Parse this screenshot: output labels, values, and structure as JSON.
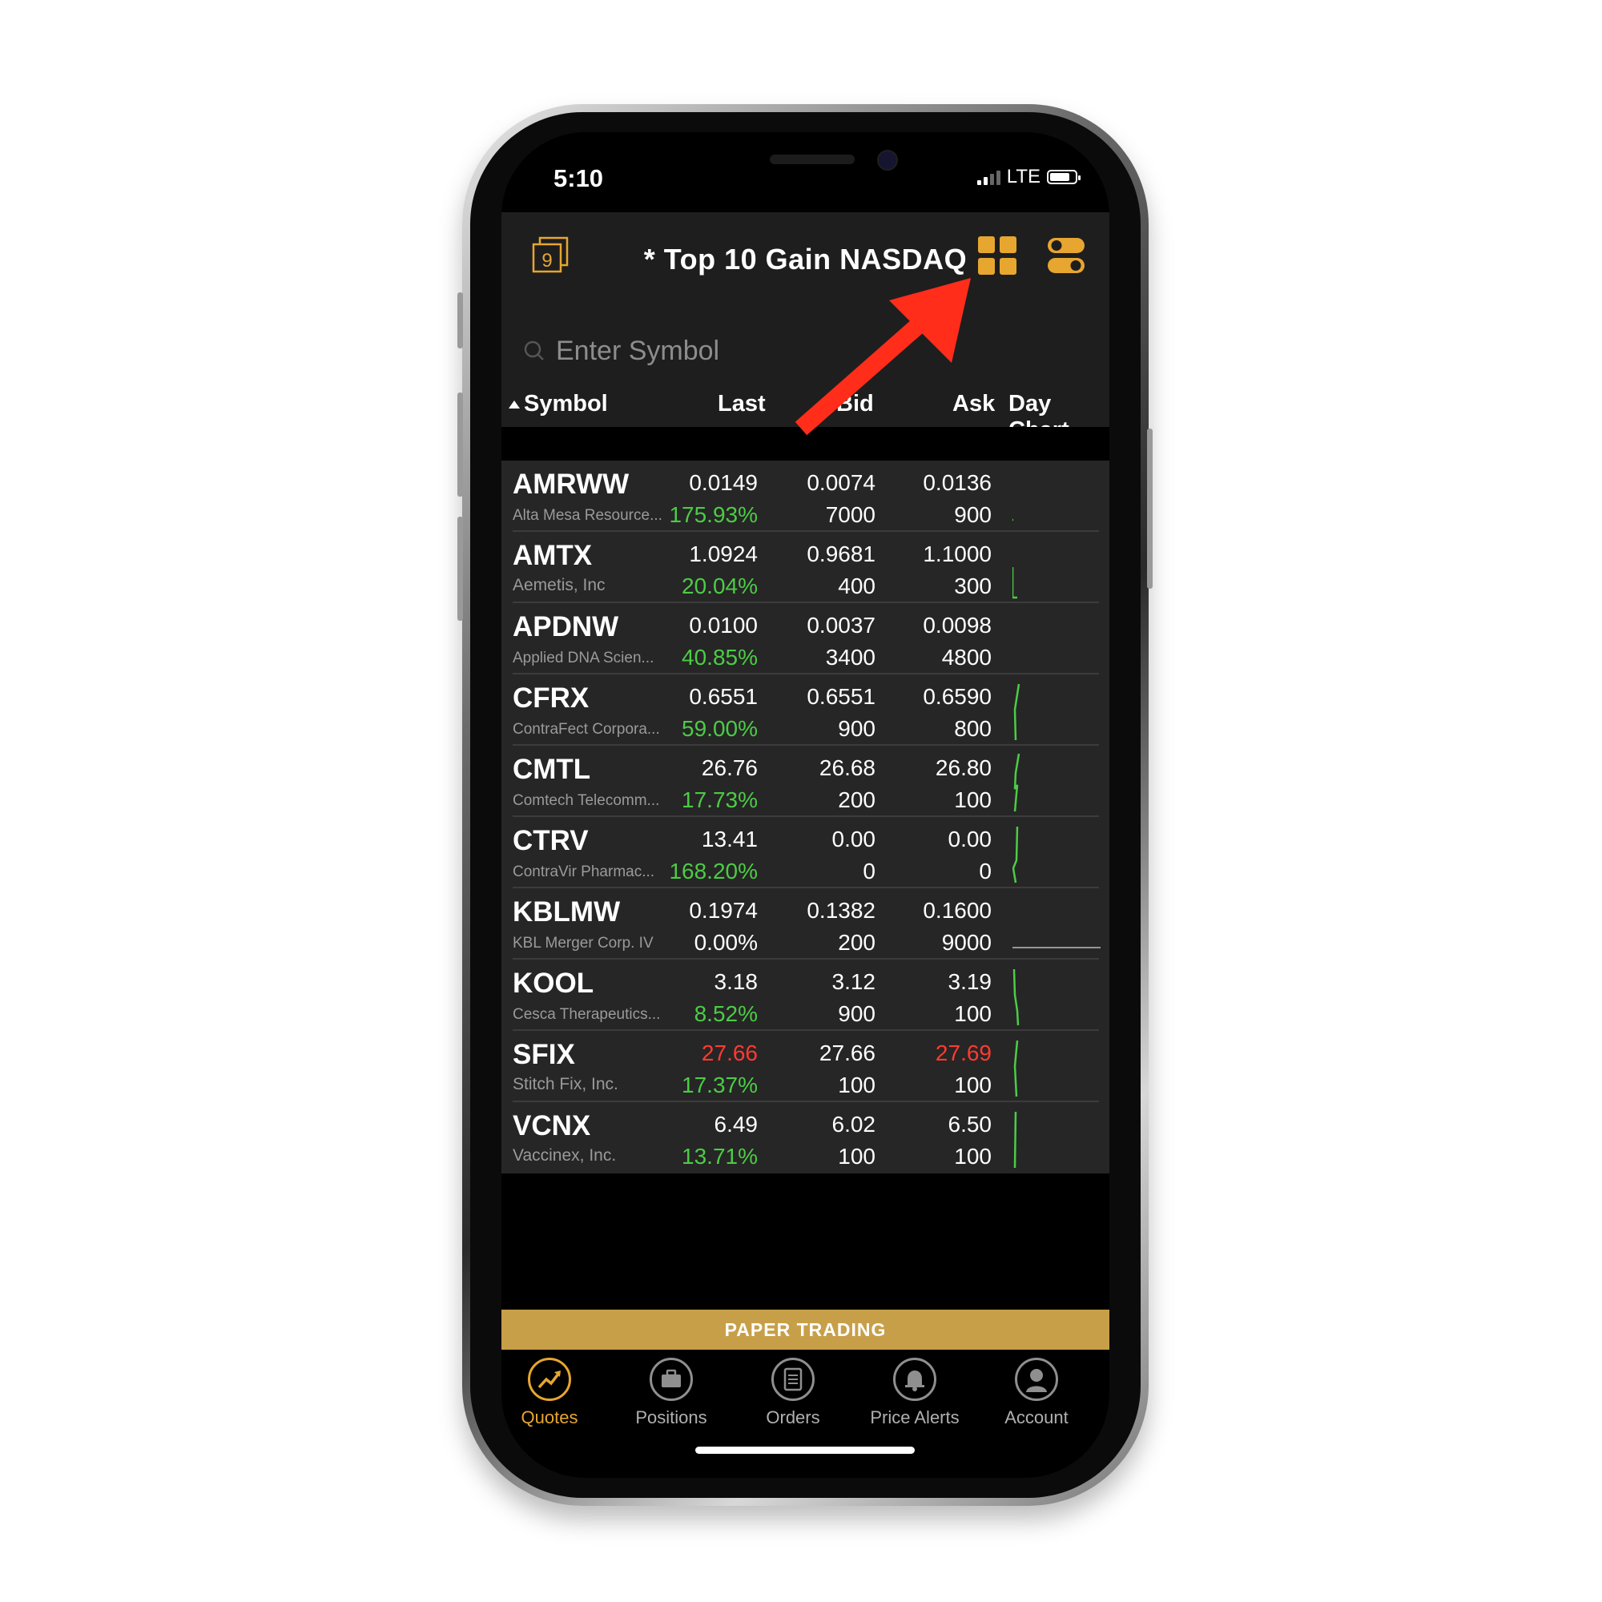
{
  "status": {
    "time": "5:10",
    "network": "LTE"
  },
  "header": {
    "title": "* Top 10 Gain NASDAQ",
    "watchlist_badge": "9"
  },
  "search": {
    "placeholder": "Enter Symbol"
  },
  "columns": {
    "symbol": "Symbol",
    "last": "Last",
    "bid": "Bid",
    "ask": "Ask",
    "chart": "Day Chart"
  },
  "rows": [
    {
      "symbol": "AMRWW",
      "name": "Alta Mesa Resource...",
      "last": "0.0149",
      "change": "175.93%",
      "bid": "0.0074",
      "bid_size": "7000",
      "ask": "0.0136",
      "ask_size": "900"
    },
    {
      "symbol": "AMTX",
      "name": "Aemetis, Inc",
      "last": "1.0924",
      "change": "20.04%",
      "bid": "0.9681",
      "bid_size": "400",
      "ask": "1.1000",
      "ask_size": "300"
    },
    {
      "symbol": "APDNW",
      "name": "Applied DNA Scien...",
      "last": "0.0100",
      "change": "40.85%",
      "bid": "0.0037",
      "bid_size": "3400",
      "ask": "0.0098",
      "ask_size": "4800"
    },
    {
      "symbol": "CFRX",
      "name": "ContraFect Corpora...",
      "last": "0.6551",
      "change": "59.00%",
      "bid": "0.6551",
      "bid_size": "900",
      "ask": "0.6590",
      "ask_size": "800"
    },
    {
      "symbol": "CMTL",
      "name": "Comtech Telecomm...",
      "last": "26.76",
      "change": "17.73%",
      "bid": "26.68",
      "bid_size": "200",
      "ask": "26.80",
      "ask_size": "100"
    },
    {
      "symbol": "CTRV",
      "name": "ContraVir Pharmac...",
      "last": "13.41",
      "change": "168.20%",
      "bid": "0.00",
      "bid_size": "0",
      "ask": "0.00",
      "ask_size": "0"
    },
    {
      "symbol": "KBLMW",
      "name": "KBL Merger Corp. IV",
      "last": "0.1974",
      "change": "0.00%",
      "bid": "0.1382",
      "bid_size": "200",
      "ask": "0.1600",
      "ask_size": "9000"
    },
    {
      "symbol": "KOOL",
      "name": "Cesca Therapeutics...",
      "last": "3.18",
      "change": "8.52%",
      "bid": "3.12",
      "bid_size": "900",
      "ask": "3.19",
      "ask_size": "100"
    },
    {
      "symbol": "SFIX",
      "name": "Stitch Fix, Inc.",
      "last": "27.66",
      "change": "17.37%",
      "bid": "27.66",
      "bid_size": "100",
      "ask": "27.69",
      "ask_size": "100"
    },
    {
      "symbol": "VCNX",
      "name": "Vaccinex, Inc.",
      "last": "6.49",
      "change": "13.71%",
      "bid": "6.02",
      "bid_size": "100",
      "ask": "6.50",
      "ask_size": "100"
    }
  ],
  "banner": {
    "label": "PAPER TRADING"
  },
  "tabs": {
    "quotes": "Quotes",
    "positions": "Positions",
    "orders": "Orders",
    "price_alerts": "Price Alerts",
    "account": "Account"
  },
  "colors": {
    "accent": "#e7a630",
    "positive": "#4ccc45",
    "negative": "#ff3b30",
    "banner": "#c89f49"
  }
}
